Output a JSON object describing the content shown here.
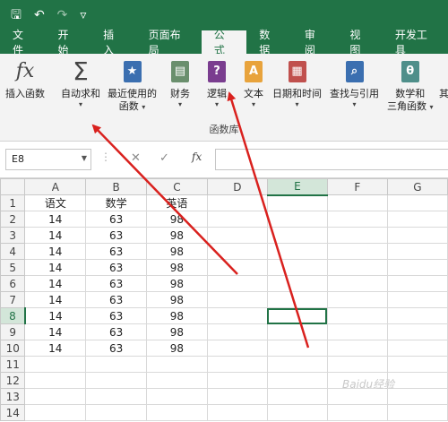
{
  "qat": {
    "icons": [
      "save-icon",
      "undo-icon",
      "redo-icon",
      "customize-icon"
    ],
    "glyphs": [
      "🖫",
      "↶",
      "↷",
      "▿"
    ]
  },
  "tabs": [
    "文件",
    "开始",
    "插入",
    "页面布局",
    "公式",
    "数据",
    "审阅",
    "视图",
    "开发工具"
  ],
  "active_tab": "公式",
  "ribbon": {
    "insert_function": "插入函数",
    "autosum_line1": "自动求和",
    "recent_line1": "最近使用的",
    "recent_line2": "函数",
    "finance": "财务",
    "logic": "逻辑",
    "text": "文本",
    "datetime": "日期和时间",
    "lookup": "查找与引用",
    "math_line1": "数学和",
    "math_line2": "三角函数",
    "more_partial": "其",
    "group_label": "函数库",
    "fx_glyph": "fx",
    "sigma_glyph": "Σ",
    "logic_glyph": "?",
    "text_glyph": "A",
    "math_glyph": "θ"
  },
  "formula_bar": {
    "name_box": "E8",
    "cancel_glyph": "✕",
    "enter_glyph": "✓",
    "fx_glyph": "fx",
    "value": ""
  },
  "sheet": {
    "columns": [
      "A",
      "B",
      "C",
      "D",
      "E",
      "F",
      "G"
    ],
    "selected_column": "E",
    "selected_row": "8",
    "rows": [
      {
        "num": "1",
        "cells": [
          "语文",
          "数学",
          "英语",
          "",
          "",
          "",
          ""
        ]
      },
      {
        "num": "2",
        "cells": [
          "14",
          "63",
          "98",
          "",
          "",
          "",
          ""
        ]
      },
      {
        "num": "3",
        "cells": [
          "14",
          "63",
          "98",
          "",
          "",
          "",
          ""
        ]
      },
      {
        "num": "4",
        "cells": [
          "14",
          "63",
          "98",
          "",
          "",
          "",
          ""
        ]
      },
      {
        "num": "5",
        "cells": [
          "14",
          "63",
          "98",
          "",
          "",
          "",
          ""
        ]
      },
      {
        "num": "6",
        "cells": [
          "14",
          "63",
          "98",
          "",
          "",
          "",
          ""
        ]
      },
      {
        "num": "7",
        "cells": [
          "14",
          "63",
          "98",
          "",
          "",
          "",
          ""
        ]
      },
      {
        "num": "8",
        "cells": [
          "14",
          "63",
          "98",
          "",
          "",
          "",
          ""
        ]
      },
      {
        "num": "9",
        "cells": [
          "14",
          "63",
          "98",
          "",
          "",
          "",
          ""
        ]
      },
      {
        "num": "10",
        "cells": [
          "14",
          "63",
          "98",
          "",
          "",
          "",
          ""
        ]
      },
      {
        "num": "11",
        "cells": [
          "",
          "",
          "",
          "",
          "",
          "",
          ""
        ]
      },
      {
        "num": "12",
        "cells": [
          "",
          "",
          "",
          "",
          "",
          "",
          ""
        ]
      },
      {
        "num": "13",
        "cells": [
          "",
          "",
          "",
          "",
          "",
          "",
          ""
        ]
      },
      {
        "num": "14",
        "cells": [
          "",
          "",
          "",
          "",
          "",
          "",
          ""
        ]
      }
    ]
  },
  "colors": {
    "excel_green": "#217346",
    "arrow_red": "#d9211e",
    "finance_icon": "#6a8f6d",
    "logic_icon": "#7a3d8f",
    "text_icon": "#e8a33c",
    "datetime_icon": "#c0504d",
    "lookup_icon": "#3b6fb0",
    "math_icon": "#4f8f8a",
    "recent_icon": "#3b6fb0"
  },
  "watermark": "Baidu经验"
}
